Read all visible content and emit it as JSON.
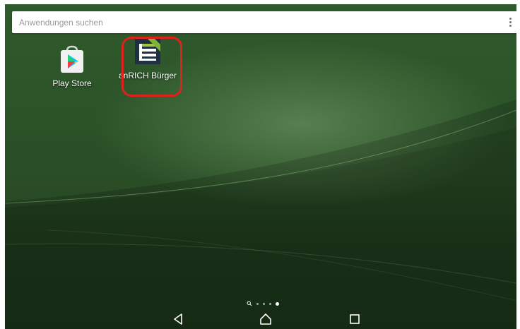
{
  "search": {
    "placeholder": "Anwendungen suchen",
    "menu_icon": "overflow-menu-icon"
  },
  "apps": [
    {
      "label": "Play Store",
      "icon": "play-store-icon"
    },
    {
      "label": "anRICH Bürger",
      "icon": "anrich-icon",
      "highlighted": true,
      "highlight_color": "#e0201a"
    }
  ],
  "pager": {
    "pages": 4,
    "current_page": 4,
    "search_page_icon": "search-page-icon"
  },
  "navbar": {
    "back": "back-icon",
    "home": "home-icon",
    "recents": "recents-icon"
  },
  "colors": {
    "wallpaper": "#2c5429",
    "highlight": "#e0201a",
    "label": "#ffffff"
  }
}
